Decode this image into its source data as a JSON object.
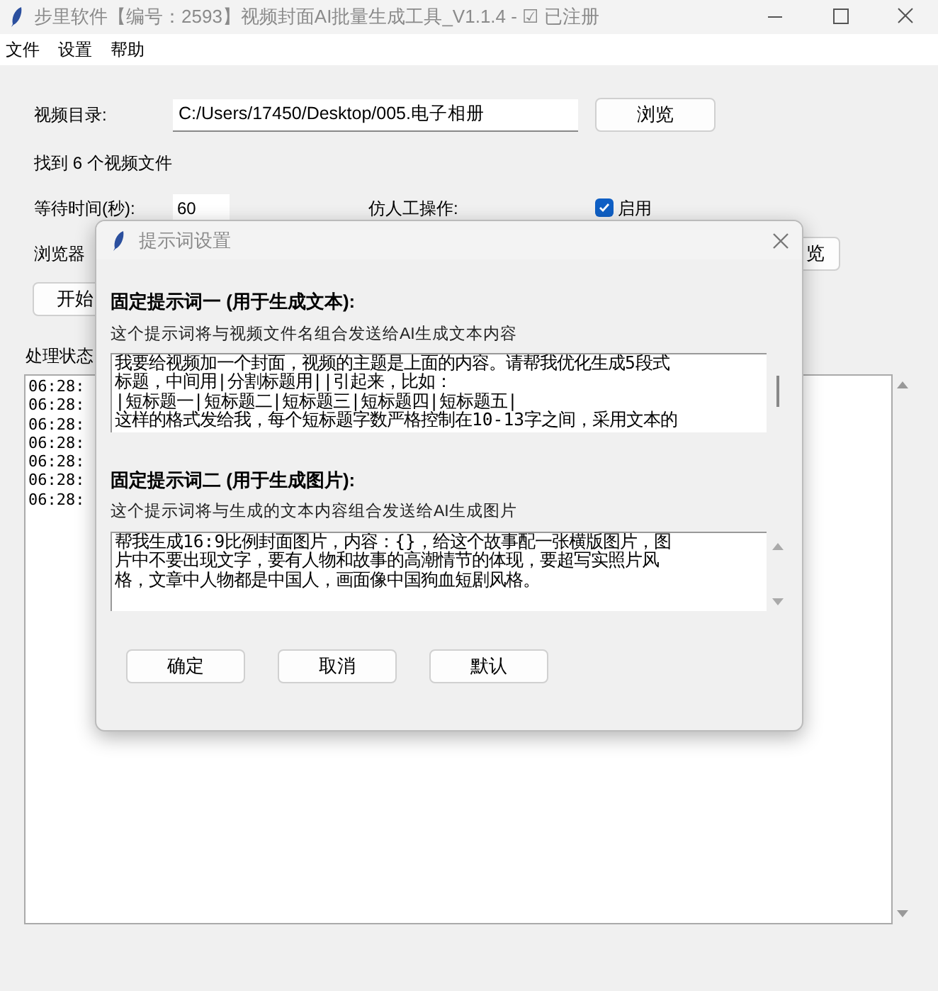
{
  "window": {
    "title": "步里软件【编号：2593】视频封面AI批量生成工具_V1.1.4 - ☑ 已注册"
  },
  "menu": [
    "文件",
    "设置",
    "帮助"
  ],
  "main": {
    "dir_label": "视频目录:",
    "dir_value": "C:/Users/17450/Desktop/005.电子相册",
    "browse_button": "浏览",
    "found_text": "找到 6 个视频文件",
    "wait_label": "等待时间(秒):",
    "wait_value": "60",
    "human_label": "仿人工操作:",
    "human_option": {
      "label": "启用",
      "checked": true
    },
    "browser_label": "浏览器",
    "browse_button_2": "览",
    "start_button": "开始",
    "status_label": "处理状态",
    "log": [
      "06:28:",
      "06:28:",
      "06:28:",
      "06:28:",
      "06:28:",
      "06:28:",
      "06:28:"
    ]
  },
  "dialog": {
    "title": "提示词设置",
    "prompts": [
      {
        "heading": "固定提示词一 (用于生成文本):",
        "hint": "这个提示词将与视频文件名组合发送给AI生成文本内容",
        "lines": [
          "我要给视频加一个封面，视频的主题是上面的内容。请帮我优化生成5段式",
          "标题，中间用|分割标题用||引起来，比如：",
          "|短标题一|短标题二|短标题三|短标题四|短标题五|",
          "这样的格式发给我，每个短标题字数严格控制在10-13字之间，采用文本的"
        ],
        "kind": "thumb"
      },
      {
        "heading": "固定提示词二 (用于生成图片):",
        "hint": "这个提示词将与生成的文本内容组合发送给AI生成图片",
        "lines": [
          "帮我生成16:9比例封面图片，内容：{}，给这个故事配一张横版图片，图",
          "片中不要出现文字，要有人物和故事的高潮情节的体现，要超写实照片风",
          "格，文章中人物都是中国人，画面像中国狗血短剧风格。"
        ],
        "kind": "arrows"
      }
    ],
    "buttons": [
      "确定",
      "取消",
      "默认"
    ]
  }
}
